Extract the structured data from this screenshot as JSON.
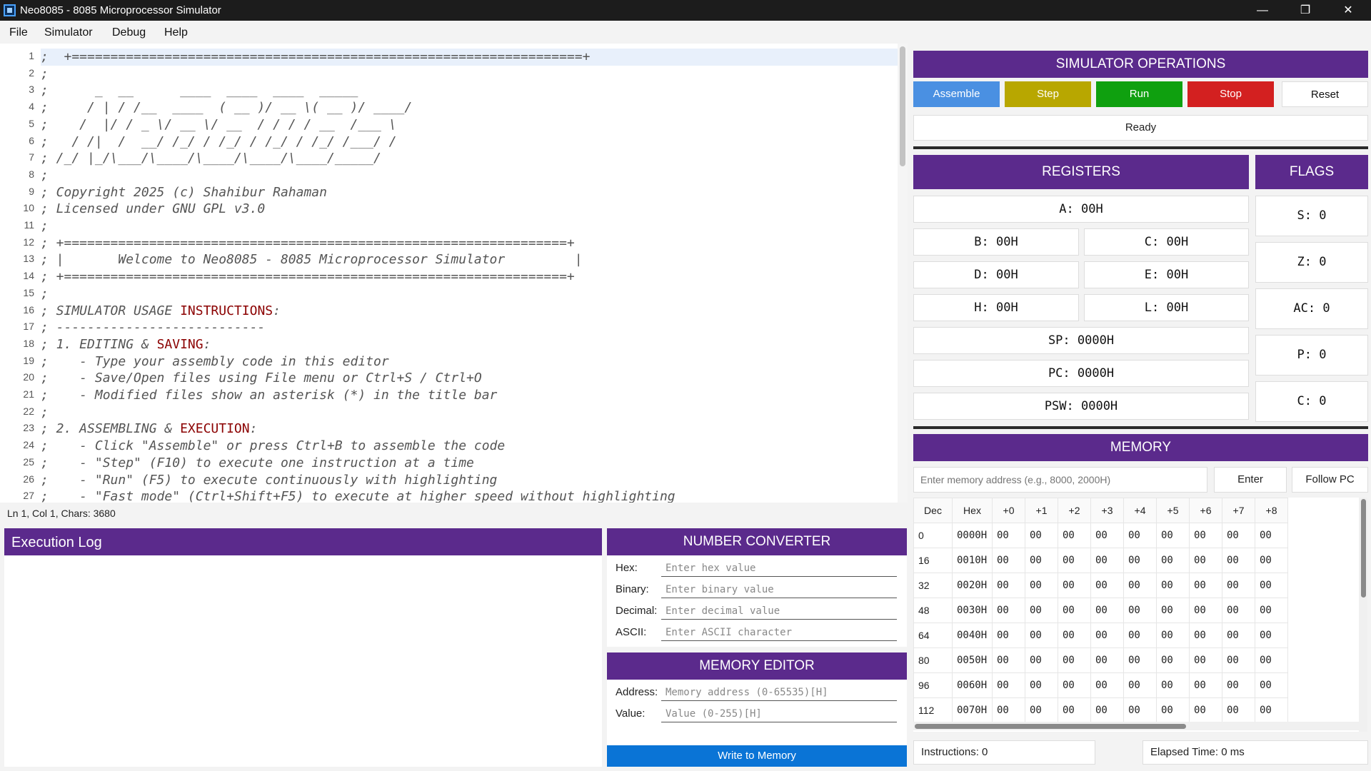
{
  "window": {
    "title": "Neo8085 - 8085 Microprocessor Simulator"
  },
  "menu": {
    "items": [
      "File",
      "Simulator",
      "Debug",
      "Help"
    ]
  },
  "editor": {
    "line_numbers": [
      "1",
      "2",
      "3",
      "4",
      "5",
      "6",
      "7",
      "8",
      "9",
      "10",
      "11",
      "12",
      "13",
      "14",
      "15",
      "16",
      "17",
      "18",
      "19",
      "20",
      "21",
      "22",
      "23",
      "24",
      "25",
      "26",
      "27"
    ],
    "status": "Ln 1, Col 1, Chars: 3680"
  },
  "exec_log": {
    "title": "Execution Log"
  },
  "number_converter": {
    "title": "NUMBER CONVERTER",
    "fields": [
      {
        "label": "Hex:",
        "placeholder": "Enter hex value"
      },
      {
        "label": "Binary:",
        "placeholder": "Enter binary value"
      },
      {
        "label": "Decimal:",
        "placeholder": "Enter decimal value"
      },
      {
        "label": "ASCII:",
        "placeholder": "Enter ASCII character"
      }
    ]
  },
  "memory_editor": {
    "title": "MEMORY EDITOR",
    "address_label": "Address:",
    "address_placeholder": "Memory address (0-65535)[H]",
    "value_label": "Value:",
    "value_placeholder": "Value (0-255)[H]",
    "write_label": "Write to Memory"
  },
  "operations": {
    "title": "SIMULATOR OPERATIONS",
    "buttons": [
      {
        "label": "Assemble",
        "color": "#4a90e2"
      },
      {
        "label": "Step",
        "color": "#b8a700"
      },
      {
        "label": "Run",
        "color": "#0fa00f"
      },
      {
        "label": "Stop",
        "color": "#d32020"
      },
      {
        "label": "Reset",
        "color": "#ffffff"
      }
    ],
    "status": "Ready"
  },
  "registers": {
    "title": "REGISTERS",
    "A": "A: 00H",
    "B": "B: 00H",
    "C": "C: 00H",
    "D": "D: 00H",
    "E": "E: 00H",
    "H": "H: 00H",
    "L": "L: 00H",
    "SP": "SP: 0000H",
    "PC": "PC: 0000H",
    "PSW": "PSW: 0000H"
  },
  "flags": {
    "title": "FLAGS",
    "S": "S: 0",
    "Z": "Z: 0",
    "AC": "AC: 0",
    "P": "P: 0",
    "C": "C: 0"
  },
  "memory": {
    "title": "MEMORY",
    "address_placeholder": "Enter memory address (e.g., 8000, 2000H)",
    "enter_label": "Enter",
    "follow_label": "Follow PC",
    "columns": [
      "Dec",
      "Hex",
      "+0",
      "+1",
      "+2",
      "+3",
      "+4",
      "+5",
      "+6",
      "+7",
      "+8"
    ],
    "rows": [
      {
        "dec": "0",
        "hex": "0000H",
        "values": [
          "00",
          "00",
          "00",
          "00",
          "00",
          "00",
          "00",
          "00",
          "00"
        ]
      },
      {
        "dec": "16",
        "hex": "0010H",
        "values": [
          "00",
          "00",
          "00",
          "00",
          "00",
          "00",
          "00",
          "00",
          "00"
        ]
      },
      {
        "dec": "32",
        "hex": "0020H",
        "values": [
          "00",
          "00",
          "00",
          "00",
          "00",
          "00",
          "00",
          "00",
          "00"
        ]
      },
      {
        "dec": "48",
        "hex": "0030H",
        "values": [
          "00",
          "00",
          "00",
          "00",
          "00",
          "00",
          "00",
          "00",
          "00"
        ]
      },
      {
        "dec": "64",
        "hex": "0040H",
        "values": [
          "00",
          "00",
          "00",
          "00",
          "00",
          "00",
          "00",
          "00",
          "00"
        ]
      },
      {
        "dec": "80",
        "hex": "0050H",
        "values": [
          "00",
          "00",
          "00",
          "00",
          "00",
          "00",
          "00",
          "00",
          "00"
        ]
      },
      {
        "dec": "96",
        "hex": "0060H",
        "values": [
          "00",
          "00",
          "00",
          "00",
          "00",
          "00",
          "00",
          "00",
          "00"
        ]
      },
      {
        "dec": "112",
        "hex": "0070H",
        "values": [
          "00",
          "00",
          "00",
          "00",
          "00",
          "00",
          "00",
          "00",
          "00"
        ]
      }
    ]
  },
  "footer": {
    "instructions": "Instructions: 0",
    "elapsed": "Elapsed Time: 0 ms"
  }
}
